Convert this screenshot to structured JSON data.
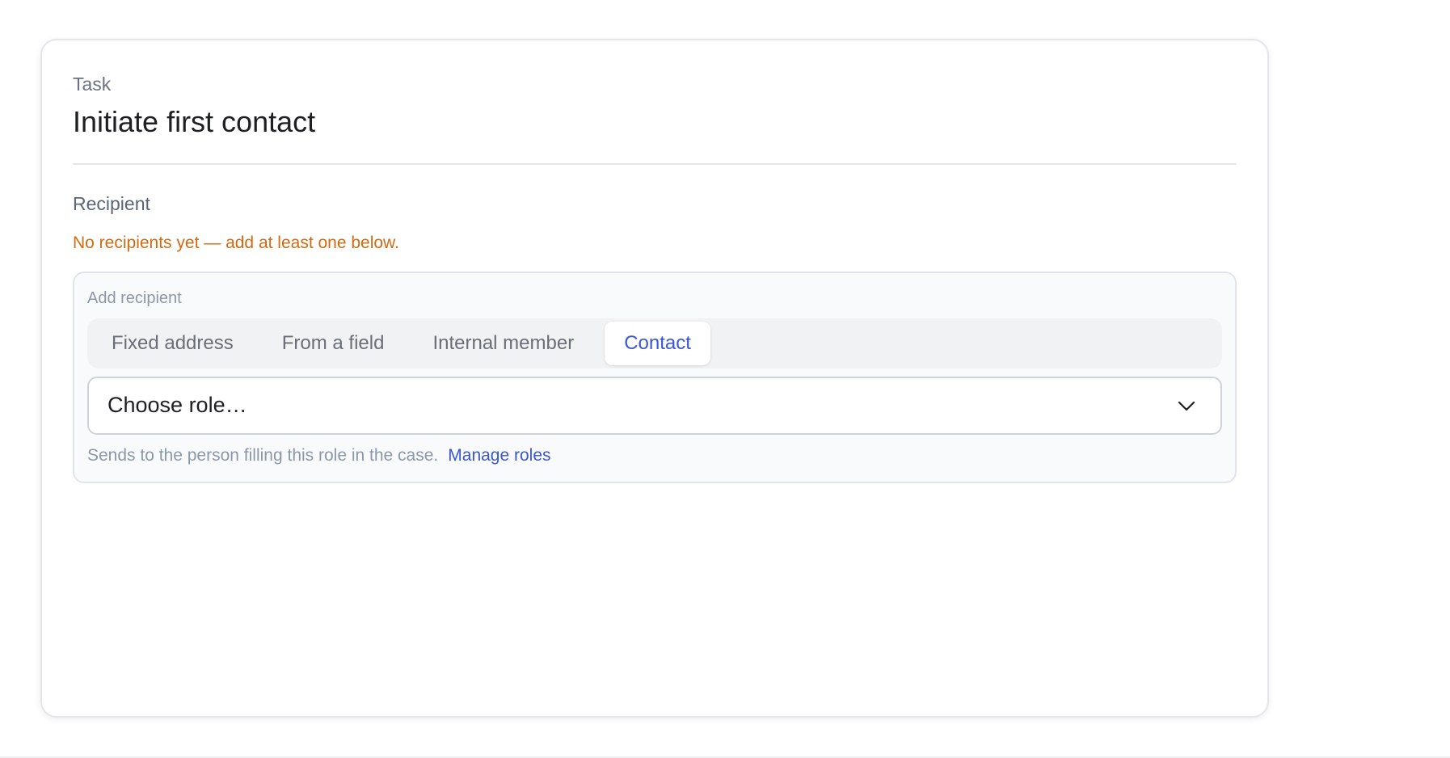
{
  "task": {
    "label": "Task",
    "title": "Initiate first contact"
  },
  "recipient": {
    "section_label": "Recipient",
    "warning": "No recipients yet — add at least one below."
  },
  "add_recipient": {
    "label": "Add recipient",
    "tabs": [
      {
        "label": "Fixed address",
        "active": false
      },
      {
        "label": "From a field",
        "active": false
      },
      {
        "label": "Internal member",
        "active": false
      },
      {
        "label": "Contact",
        "active": true
      }
    ],
    "select": {
      "value": "Choose role…",
      "icon": "chevron-down-icon"
    },
    "helper_text": "Sends to the person filling this role in the case.",
    "helper_link": "Manage roles"
  },
  "colors": {
    "accent": "#3957d6",
    "warning": "#d26a12",
    "muted": "#8c97a8"
  }
}
